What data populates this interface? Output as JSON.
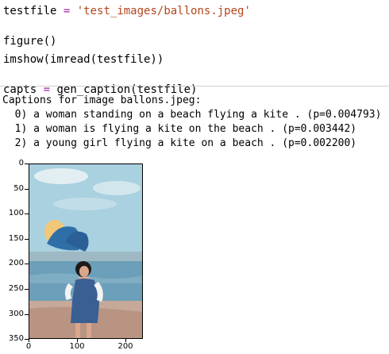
{
  "code_cell": {
    "line1": {
      "var": "testfile",
      "op": "=",
      "value": "'test_images/ballons.jpeg'"
    },
    "line2": "figure()",
    "line3": "imshow(imread(testfile))",
    "line4": {
      "var": "capts",
      "op": "=",
      "value": "gen_caption(testfile)"
    }
  },
  "output": {
    "header": "Captions for image ballons.jpeg:",
    "captions": [
      "  0) a woman standing on a beach flying a kite . (p=0.004793)",
      "  1) a woman is flying a kite on the beach . (p=0.003442)",
      "  2) a young girl flying a kite on a beach . (p=0.002200)"
    ]
  },
  "plot": {
    "y_ticks": [
      "0",
      "50",
      "100",
      "150",
      "200",
      "250",
      "300",
      "350"
    ],
    "x_ticks": [
      "0",
      "100",
      "200"
    ],
    "colors": {
      "sky": "#a9d1e0",
      "water": "#6c9fb9",
      "balloon_blue": "#2e6fa8",
      "balloon_yellow": "#f1c878",
      "sand": "#c7a99a",
      "dress": "#3a5f93"
    }
  }
}
